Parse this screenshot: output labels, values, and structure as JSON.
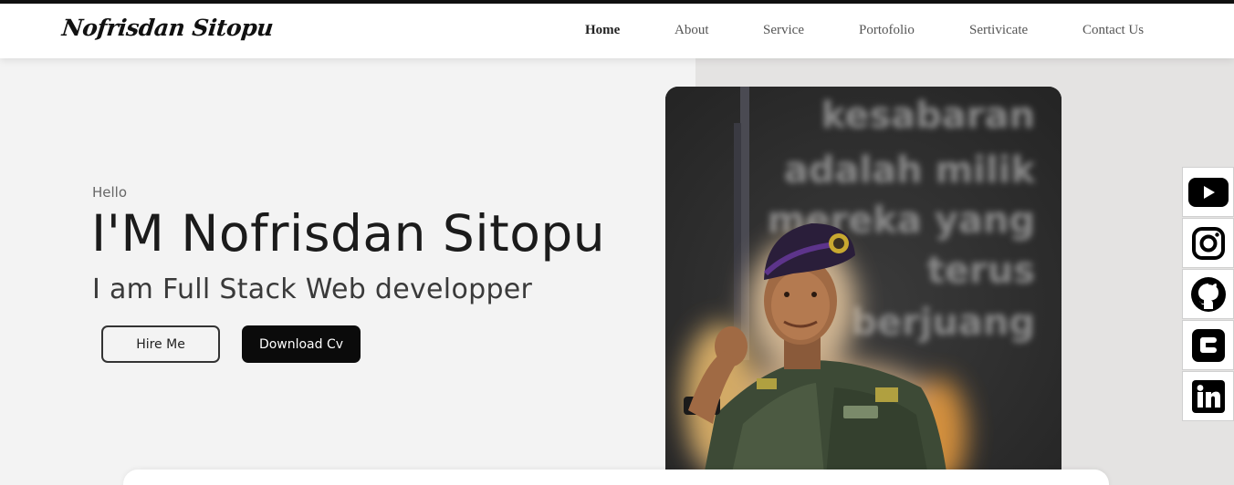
{
  "site": {
    "logo": "Nofrisdan Sitopu"
  },
  "nav": {
    "items": [
      {
        "label": "Home",
        "active": true
      },
      {
        "label": "About"
      },
      {
        "label": "Service"
      },
      {
        "label": "Portofolio"
      },
      {
        "label": "Sertivicate"
      },
      {
        "label": "Contact Us"
      }
    ]
  },
  "hero": {
    "greeting": "Hello",
    "headline": "I'M Nofrisdan Sitopu",
    "subheadline": "I am Full Stack Web developper",
    "hire_label": "Hire Me",
    "cv_label": "Download Cv",
    "photo_caption_lines": [
      "kesabaran",
      "adalah milik",
      "mereka yang",
      "terus",
      "berjuang"
    ]
  },
  "social": [
    "youtube-icon",
    "instagram-icon",
    "github-icon",
    "blogger-icon",
    "linkedin-icon"
  ],
  "colors": {
    "accent": "#0b0b0b",
    "background": "#f3f3f3",
    "panel": "#e4e3e2"
  }
}
